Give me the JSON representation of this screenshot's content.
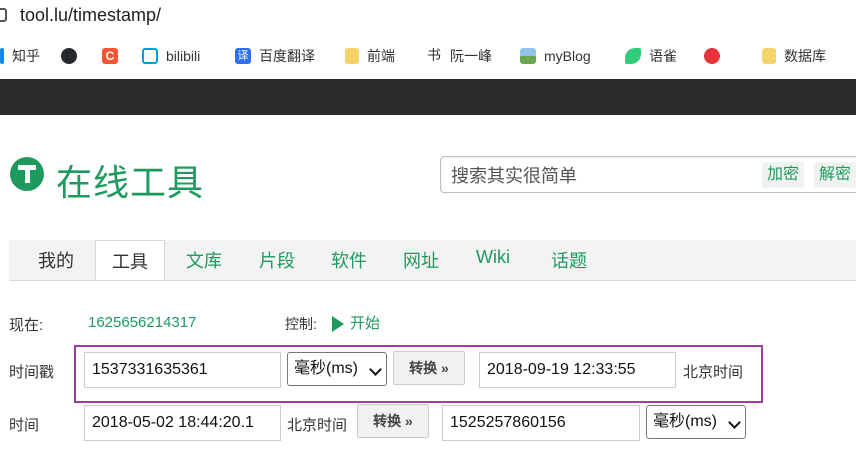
{
  "browser": {
    "url": "tool.lu/timestamp/",
    "bookmarks": [
      {
        "label": "知乎",
        "icon": "zhihu-icon",
        "color": "#0f88eb"
      },
      {
        "label": "",
        "icon": "github-icon",
        "color": "#24292e"
      },
      {
        "label": "",
        "icon": "csdn-icon",
        "color": "#fc5531"
      },
      {
        "label": "bilibili",
        "icon": "bilibili-icon",
        "color": "#00a1d6"
      },
      {
        "label": "百度翻译",
        "icon": "baidu-translate-icon",
        "color": "#2f6ff3"
      },
      {
        "label": "前端",
        "icon": "folder-icon",
        "color": "#f5d36a"
      },
      {
        "label": "阮一峰",
        "icon": "ruanyifeng-icon",
        "color": "#333333"
      },
      {
        "label": "myBlog",
        "icon": "image-icon",
        "color": "#5aa0d8"
      },
      {
        "label": "语雀",
        "icon": "yuque-icon",
        "color": "#31cc79"
      },
      {
        "label": "",
        "icon": "ie-icon",
        "color": "#e8333a"
      },
      {
        "label": "数据库",
        "icon": "folder-icon",
        "color": "#f5d36a"
      }
    ]
  },
  "header": {
    "title": "在线工具",
    "search_placeholder": "搜索其实很简单",
    "encrypt_label": "加密",
    "decrypt_label": "解密"
  },
  "nav": {
    "tabs": [
      {
        "label": "我的"
      },
      {
        "label": "工具",
        "active": true
      },
      {
        "label": "文库"
      },
      {
        "label": "片段"
      },
      {
        "label": "软件"
      },
      {
        "label": "网址"
      },
      {
        "label": "Wiki"
      },
      {
        "label": "话题"
      }
    ]
  },
  "tool": {
    "now_label": "现在:",
    "now_value": "1625656214317",
    "control_label": "控制:",
    "start_label": "开始",
    "row1": {
      "label": "时间戳",
      "input_value": "1537331635361",
      "unit": "毫秒(ms)",
      "convert_label": "转换 »",
      "output_value": "2018-09-19 12:33:55",
      "timezone": "北京时间"
    },
    "row2": {
      "label": "时间",
      "input_value": "2018-05-02 18:44:20.1",
      "timezone": "北京时间",
      "convert_label": "转换 »",
      "output_value": "1525257860156",
      "unit": "毫秒(ms)"
    }
  }
}
